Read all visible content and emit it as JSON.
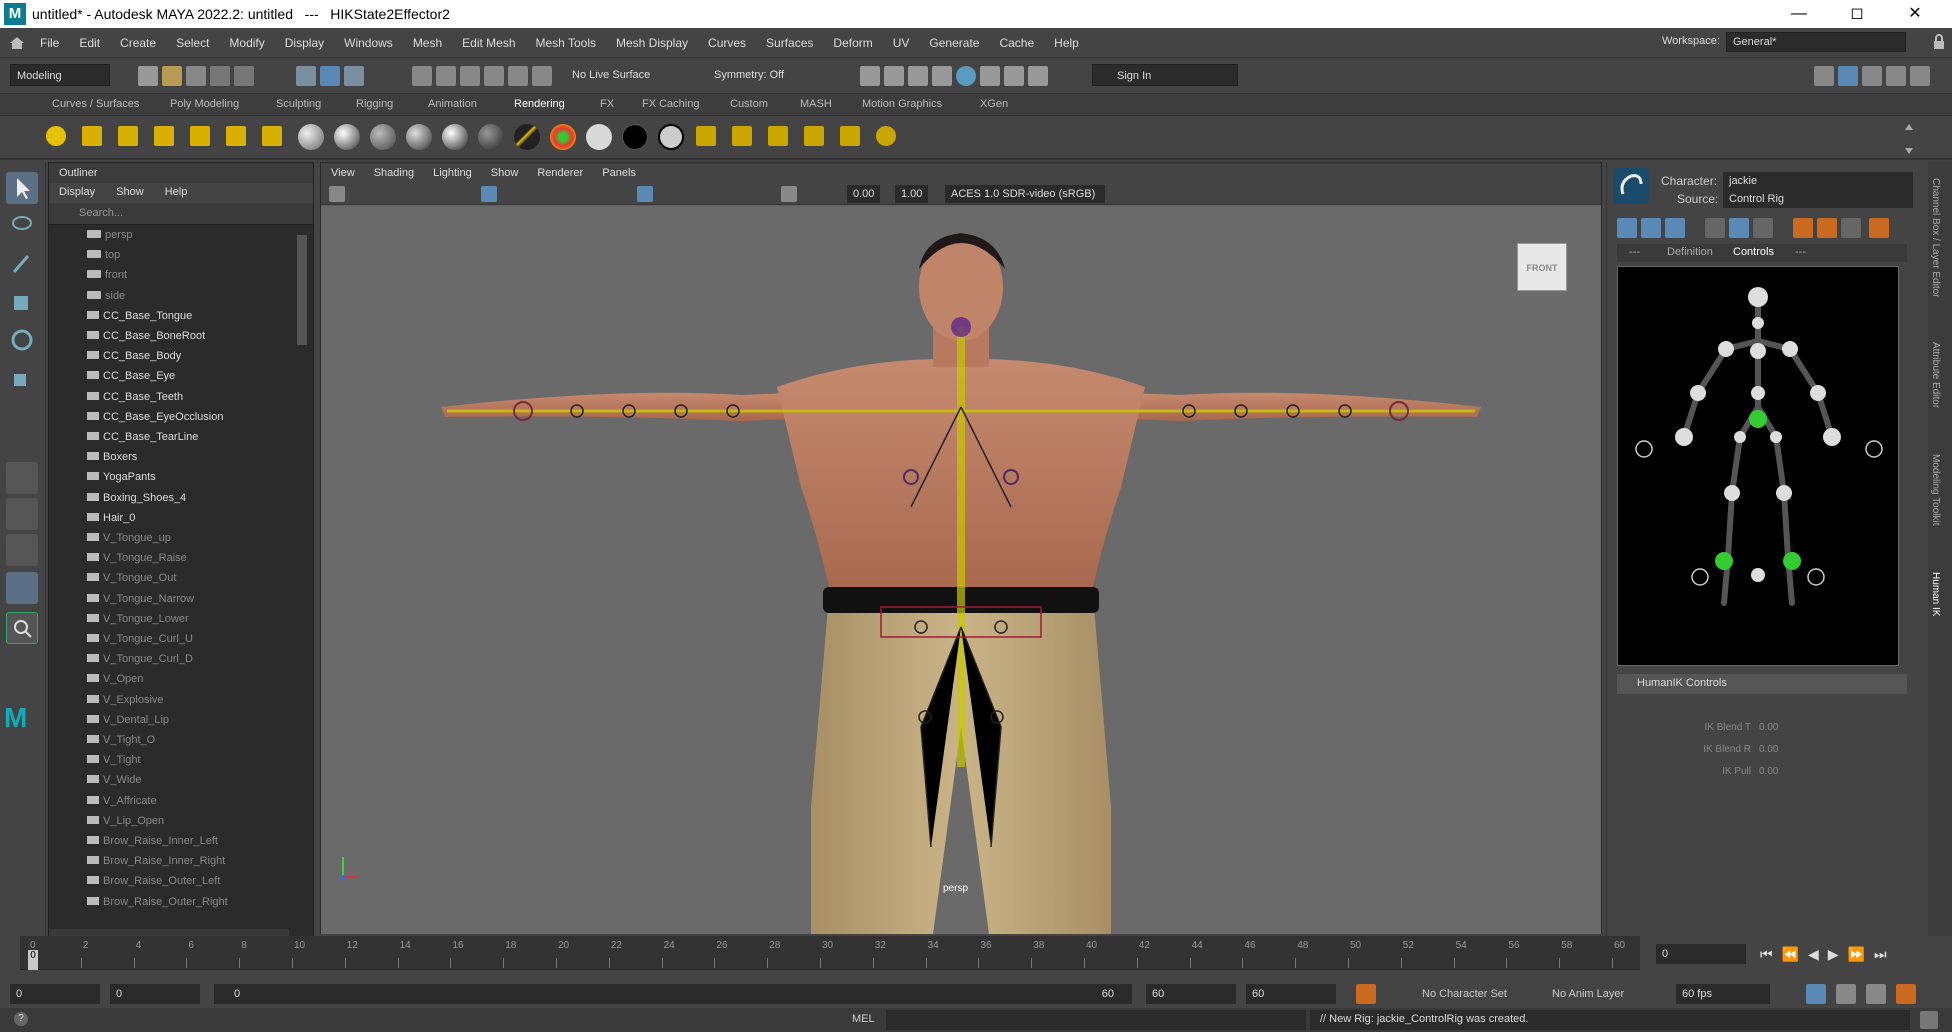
{
  "window": {
    "title": "untitled* - Autodesk MAYA 2022.2: untitled   ---   HIKState2Effector2",
    "app_icon": "M"
  },
  "menubar": {
    "items": [
      "File",
      "Edit",
      "Create",
      "Select",
      "Modify",
      "Display",
      "Windows",
      "Mesh",
      "Edit Mesh",
      "Mesh Tools",
      "Mesh Display",
      "Curves",
      "Surfaces",
      "Deform",
      "UV",
      "Generate",
      "Cache",
      "Help"
    ],
    "workspace_label": "Workspace:",
    "workspace_value": "General*"
  },
  "toolbar": {
    "mode": "Modeling",
    "live_surface": "No Live Surface",
    "symmetry": "Symmetry: Off",
    "sign_in": "Sign In"
  },
  "shelf_tabs": [
    "Curves / Surfaces",
    "Poly Modeling",
    "Sculpting",
    "Rigging",
    "Animation",
    "Rendering",
    "FX",
    "FX Caching",
    "Custom",
    "MASH",
    "Motion Graphics",
    "XGen"
  ],
  "shelf_active": "Rendering",
  "outliner": {
    "title": "Outliner",
    "menu": [
      "Display",
      "Show",
      "Help"
    ],
    "search_placeholder": "Search...",
    "items": [
      "persp",
      "top",
      "front",
      "side",
      "CC_Base_Tongue",
      "CC_Base_BoneRoot",
      "CC_Base_Body",
      "CC_Base_Eye",
      "CC_Base_Teeth",
      "CC_Base_EyeOcclusion",
      "CC_Base_TearLine",
      "Boxers",
      "YogaPants",
      "Boxing_Shoes_4",
      "Hair_0",
      "V_Tongue_up",
      "V_Tongue_Raise",
      "V_Tongue_Out",
      "V_Tongue_Narrow",
      "V_Tongue_Lower",
      "V_Tongue_Curl_U",
      "V_Tongue_Curl_D",
      "V_Open",
      "V_Explosive",
      "V_Dental_Lip",
      "V_Tight_O",
      "V_Tight",
      "V_Wide",
      "V_Affricate",
      "V_Lip_Open",
      "Brow_Raise_Inner_Left",
      "Brow_Raise_Inner_Right",
      "Brow_Raise_Outer_Left",
      "Brow_Raise_Outer_Right"
    ]
  },
  "viewport": {
    "menu": [
      "View",
      "Shading",
      "Lighting",
      "Show",
      "Renderer",
      "Panels"
    ],
    "value_a": "0.00",
    "value_b": "1.00",
    "colorspace": "ACES 1.0 SDR-video (sRGB)",
    "cube_label": "FRONT",
    "camera_label": "persp"
  },
  "hik": {
    "character_label": "Character:",
    "character_value": "jackie",
    "source_label": "Source:",
    "source_value": "Control Rig",
    "tabs": [
      "---",
      "Definition",
      "Controls",
      "---"
    ],
    "active_tab": "Controls",
    "section": "HumanIK Controls",
    "sliders": [
      {
        "label": "IK Blend T",
        "value": "0.00"
      },
      {
        "label": "IK Blend R",
        "value": "0.00"
      },
      {
        "label": "IK Pull",
        "value": "0.00"
      }
    ]
  },
  "right_tabs": [
    "Channel Box / Layer Editor",
    "Attribute Editor",
    "Modeling Toolkit",
    "Human IK"
  ],
  "timeline": {
    "ticks": [
      "0",
      "2",
      "4",
      "6",
      "8",
      "10",
      "12",
      "14",
      "16",
      "18",
      "20",
      "22",
      "24",
      "26",
      "28",
      "30",
      "32",
      "34",
      "36",
      "38",
      "40",
      "42",
      "44",
      "46",
      "48",
      "50",
      "52",
      "54",
      "56",
      "58",
      "60"
    ],
    "current_frame": "0",
    "frame_field": "0"
  },
  "range": {
    "start": "0",
    "anim_start": "0",
    "range_start": "0",
    "range_end": "60",
    "anim_end": "60",
    "end": "60",
    "character_set": "No Character Set",
    "anim_layer": "No Anim Layer",
    "fps": "60 fps"
  },
  "status": {
    "lang": "MEL",
    "message": "// New Rig: jackie_ControlRig was created."
  }
}
